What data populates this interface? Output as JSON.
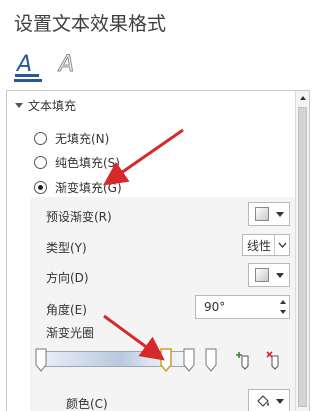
{
  "pane": {
    "title": "设置文本效果格式"
  },
  "tabs": [
    {
      "label": "A",
      "name": "text-fill-outline",
      "active": true
    },
    {
      "label": "A",
      "name": "text-effects",
      "active": false
    }
  ],
  "section": {
    "title": "文本填充",
    "expanded": true
  },
  "fill_options": [
    {
      "label": "无填充(N)",
      "selected": false
    },
    {
      "label": "纯色填充(S)",
      "selected": false
    },
    {
      "label": "渐变填充(G)",
      "selected": true
    }
  ],
  "gradient": {
    "preset_label": "预设渐变(R)",
    "type_label": "类型(Y)",
    "type_value": "线性",
    "direction_label": "方向(D)",
    "angle_label": "角度(E)",
    "angle_value": "90°",
    "stops_label": "渐变光圈",
    "stop_count": 4,
    "selected_stop_index": 2,
    "color_label": "颜色(C)"
  },
  "colors": {
    "accent": "#2b579a",
    "annotation_arrow": "#d62a2a"
  }
}
